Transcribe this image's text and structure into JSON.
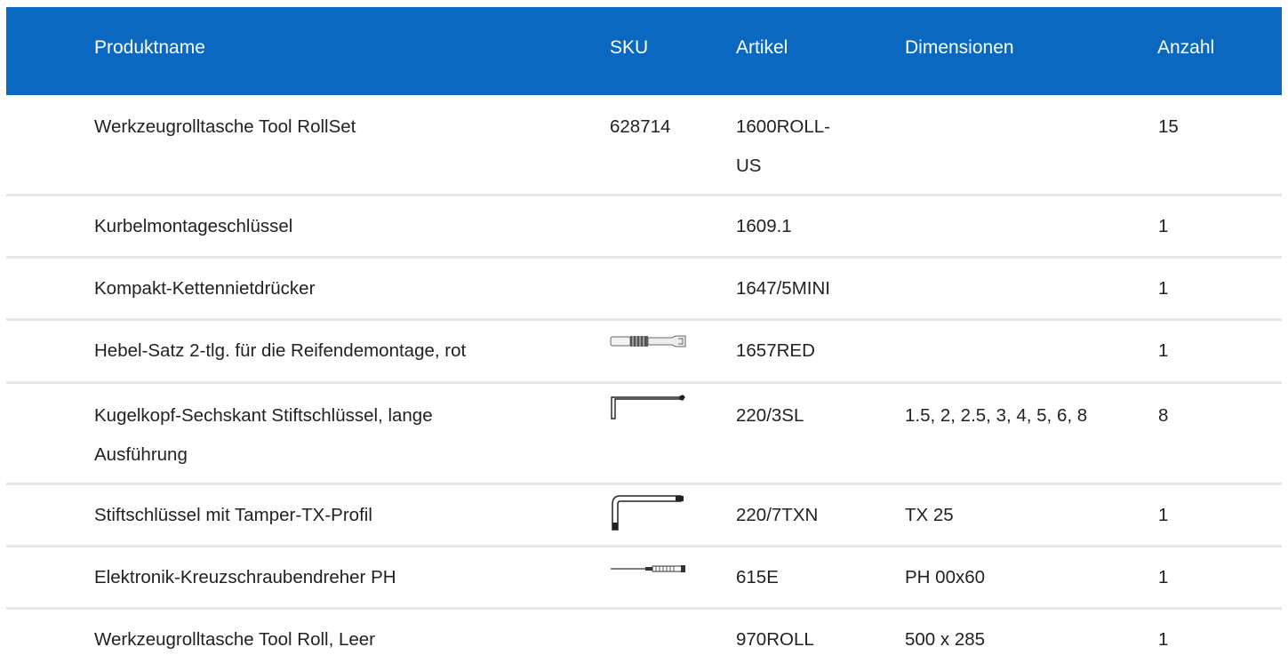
{
  "header": {
    "product_name": "Produktname",
    "sku": "SKU",
    "article": "Artikel",
    "dimensions": "Dimensionen",
    "quantity": "Anzahl"
  },
  "colors": {
    "header_bg": "#0a68c0",
    "header_text": "#ffffff",
    "row_divider": "#e6e6e6"
  },
  "rows": [
    {
      "name": "Werkzeugrolltasche Tool RollSet",
      "sku": "628714",
      "article_line1": "1600ROLL-",
      "article_line2": "US",
      "dimensions": "",
      "quantity": "15"
    },
    {
      "name": "Kurbelmontageschlüssel",
      "sku": "",
      "article": "1609.1",
      "dimensions": "",
      "quantity": "1"
    },
    {
      "name": "Kompakt-Kettennietdrücker",
      "sku": "",
      "article": "1647/5MINI",
      "dimensions": "",
      "quantity": "1"
    },
    {
      "name": "Hebel-Satz 2-tlg. für die Reifendemontage, rot",
      "sku_icon": "tire-lever-icon",
      "article": "1657RED",
      "dimensions": "",
      "quantity": "1"
    },
    {
      "name_line1": "Kugelkopf-Sechskant Stiftschlüssel, lange",
      "name_line2": "Ausführung",
      "sku_icon": "hex-key-icon",
      "article": "220/3SL",
      "dimensions": "1.5, 2, 2.5, 3, 4, 5, 6, 8",
      "quantity": "8"
    },
    {
      "name": "Stiftschlüssel mit Tamper-TX-Profil",
      "sku_icon": "torx-key-icon",
      "article": "220/7TXN",
      "dimensions": "TX 25",
      "quantity": "1"
    },
    {
      "name": "Elektronik-Kreuzschraubendreher PH",
      "sku_icon": "screwdriver-icon",
      "article": "615E",
      "dimensions": "PH 00x60",
      "quantity": "1"
    },
    {
      "name": "Werkzeugrolltasche Tool Roll, Leer",
      "sku": "",
      "article": "970ROLL",
      "dimensions": "500 x 285",
      "quantity": "1"
    }
  ]
}
